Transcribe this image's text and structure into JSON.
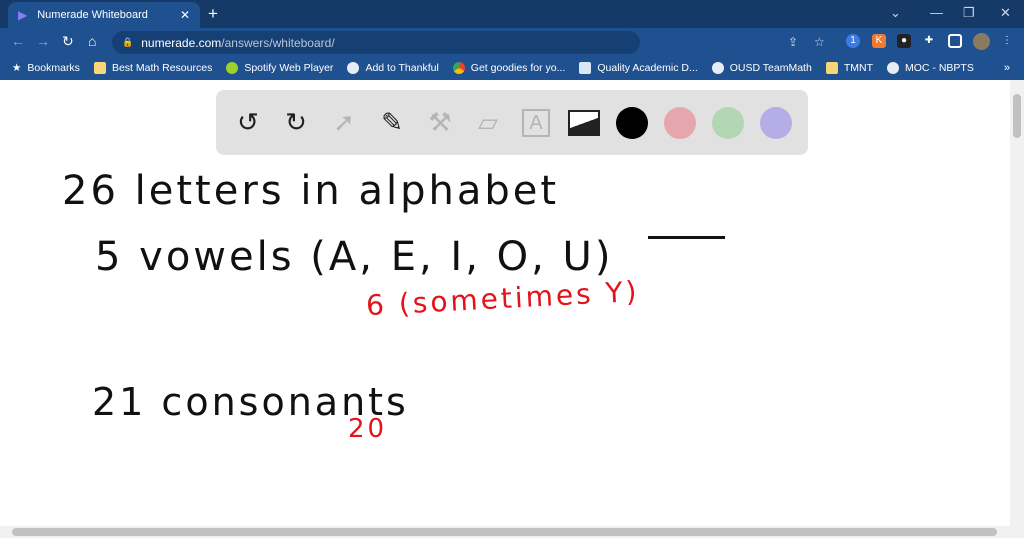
{
  "browser": {
    "tab_title": "Numerade Whiteboard",
    "url_host": "numerade.com",
    "url_path": "/answers/whiteboard/"
  },
  "bookmarks": [
    "Bookmarks",
    "Best Math Resources",
    "Spotify Web Player",
    "Add to Thankful",
    "Get goodies for yo...",
    "Quality Academic D...",
    "OUSD TeamMath",
    "TMNT",
    "MOC - NBPTS"
  ],
  "toolbar": {
    "colors": [
      "#000000",
      "#e6a6ad",
      "#b3d6b3",
      "#b5ade6"
    ]
  },
  "whiteboard": {
    "line1": "26 letters in alphabet",
    "line2": "5 vowels (A, E, I, O, U)",
    "note1": "6 (sometimes Y)",
    "line3": "21 consonants",
    "note2": "20",
    "ink_color": "#111111",
    "accent_color": "#e3131b"
  }
}
